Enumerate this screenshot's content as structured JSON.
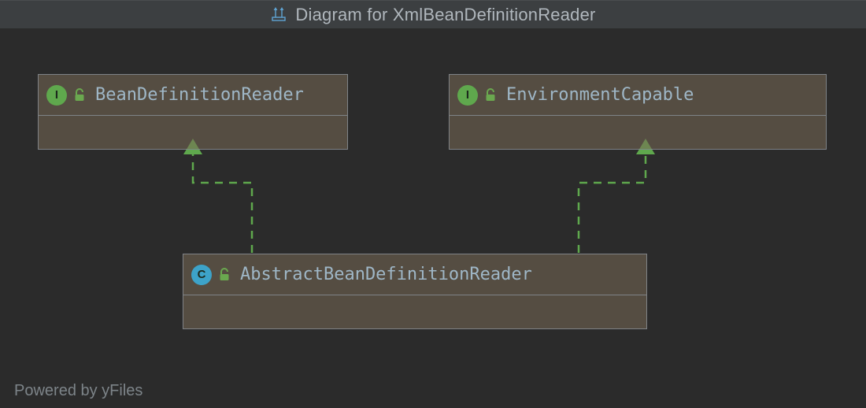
{
  "tab": {
    "icon": "diagram-icon",
    "title": "Diagram for XmlBeanDefinitionReader"
  },
  "nodes": {
    "n1": {
      "kind": "interface",
      "kind_letter": "I",
      "lock": "unlocked",
      "name": "BeanDefinitionReader"
    },
    "n2": {
      "kind": "interface",
      "kind_letter": "I",
      "lock": "unlocked",
      "name": "EnvironmentCapable"
    },
    "n3": {
      "kind": "class",
      "kind_letter": "C",
      "lock": "unlocked",
      "name": "AbstractBeanDefinitionReader"
    }
  },
  "edges": [
    {
      "from": "n3",
      "to": "n1",
      "type": "implements"
    },
    {
      "from": "n3",
      "to": "n2",
      "type": "implements"
    }
  ],
  "footer": {
    "text": "Powered by yFiles"
  },
  "colors": {
    "background": "#2b2b2b",
    "tab_background": "#3c3f41",
    "node_fill": "rgba(120,105,85,0.55)",
    "node_border": "#7f8387",
    "text": "#9fb7c7",
    "interface_badge": "#5fa84d",
    "class_badge": "#3da3c9",
    "connector_green": "#5fa84d",
    "footer_text": "#7d8489"
  }
}
